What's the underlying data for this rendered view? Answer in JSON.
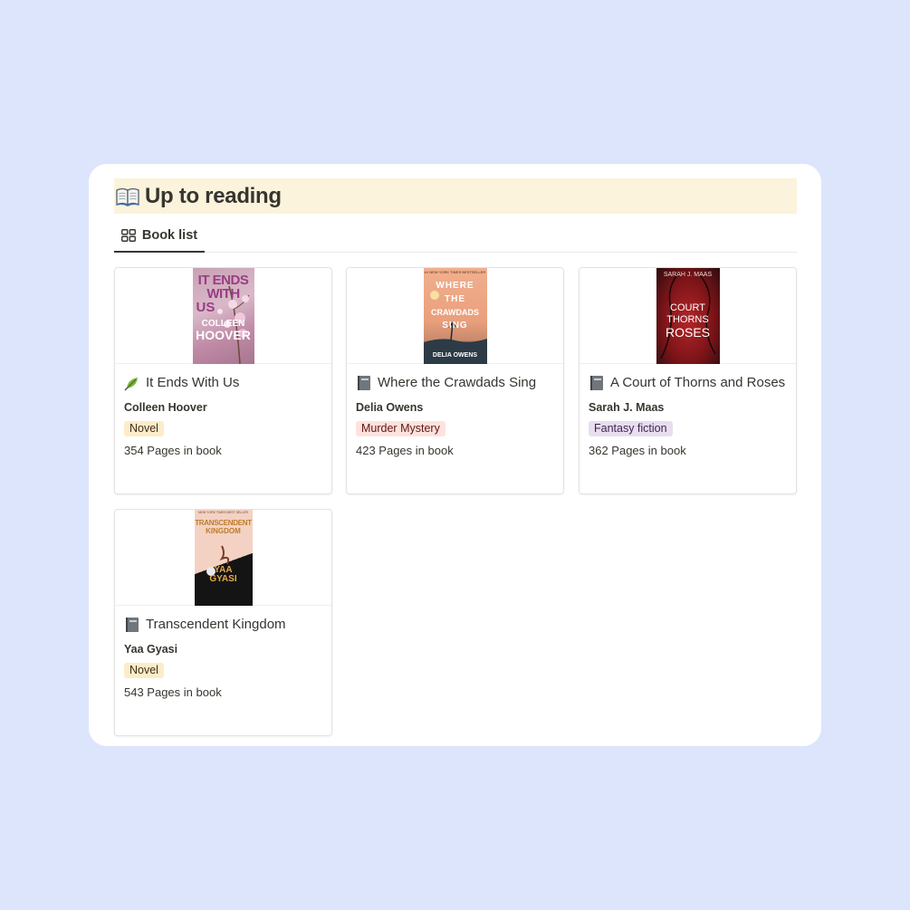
{
  "page": {
    "title": "Up to reading",
    "title_icon": "open-book-icon"
  },
  "view_tab": {
    "label": "Book list",
    "icon": "gallery-grid-icon"
  },
  "colors": {
    "background": "#dde5fd",
    "title_highlight": "#fbf3db",
    "tag_novel": "#fdecc8",
    "tag_mystery": "#ffe2dd",
    "tag_fantasy": "#e8deee"
  },
  "books": [
    {
      "title": "It Ends With Us",
      "icon": "leaf-icon",
      "author": "Colleen Hoover",
      "genre": "Novel",
      "pages": "354 Pages in book",
      "cover": {
        "line1": "IT ENDS",
        "line2": "WITH",
        "line3": "US",
        "line4": "COLLEEN",
        "line5": "HOOVER"
      }
    },
    {
      "title": "Where the Crawdads Sing",
      "icon": "book-icon",
      "author": "Delia Owens",
      "genre": "Murder Mystery",
      "pages": "423 Pages in book",
      "cover": {
        "line1": "WHERE",
        "line2": "THE",
        "line3": "CRAWDADS",
        "line4": "SING",
        "line5": "DELIA OWENS"
      }
    },
    {
      "title": "A Court of Thorns and Roses",
      "icon": "book-icon",
      "author": "Sarah J. Maas",
      "genre": "Fantasy fiction",
      "pages": "362 Pages in book",
      "cover": {
        "line1": "SARAH J. MAAS",
        "line2": "COURT",
        "line3": "THORNS",
        "line4": "ROSES"
      }
    },
    {
      "title": "Transcendent Kingdom",
      "icon": "book-icon",
      "author": "Yaa Gyasi",
      "genre": "Novel",
      "pages": "543 Pages in book",
      "cover": {
        "line1": "TRANSCENDENT",
        "line2": "KINGDOM",
        "line3": "YAA",
        "line4": "GYASI"
      }
    }
  ]
}
